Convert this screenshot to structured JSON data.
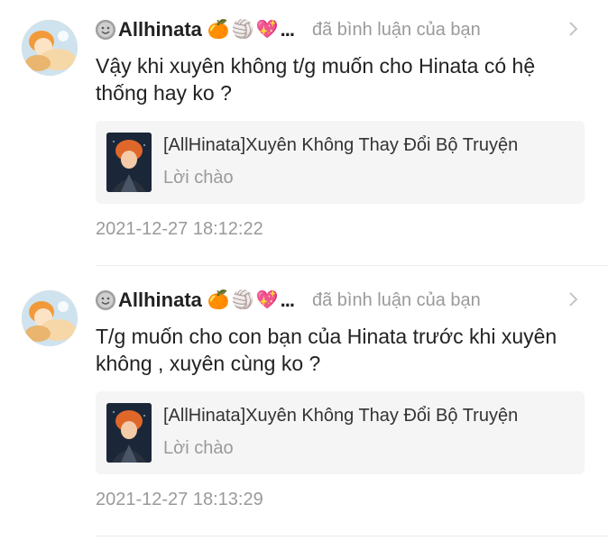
{
  "notifications": [
    {
      "username": "Allhinata",
      "emojis": [
        "🍊",
        "🏐",
        "💖"
      ],
      "ellipsis": "...",
      "action": "đã bình luận của bạn",
      "comment": "Vậy khi xuyên không t/g muốn cho Hinata có hệ thống hay ko ?",
      "story_title": "[AllHinata]Xuyên Không Thay Đổi Bộ Truyện",
      "chapter": "Lời chào",
      "timestamp": "2021-12-27 18:12:22"
    },
    {
      "username": "Allhinata",
      "emojis": [
        "🍊",
        "🏐",
        "💖"
      ],
      "ellipsis": "...",
      "action": "đã bình luận của bạn",
      "comment": "T/g muốn cho con bạn của Hinata trước khi xuyên không , xuyên cùng ko ?",
      "story_title": "[AllHinata]Xuyên Không Thay Đổi Bộ Truyện",
      "chapter": "Lời chào",
      "timestamp": "2021-12-27 18:13:29"
    }
  ],
  "icons": {
    "badge": "smiley-face-icon",
    "chevron": "chevron-right-icon"
  },
  "colors": {
    "text_primary": "#222222",
    "text_secondary": "#9a9a9a",
    "card_background": "#f5f5f5",
    "divider": "#ececec"
  }
}
